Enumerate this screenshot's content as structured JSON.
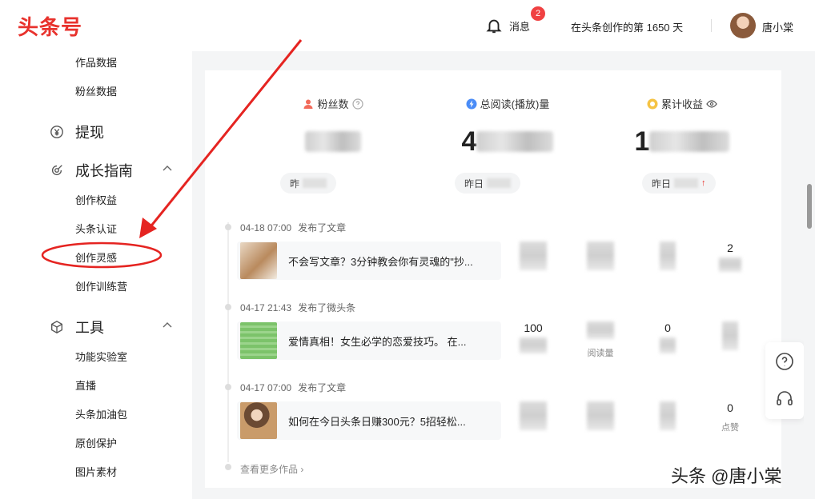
{
  "brand": {
    "logo_text": "头条号",
    "color": "#e8322d"
  },
  "header": {
    "messages_label": "消息",
    "messages_count": "2",
    "days_text": "在头条创作的第 1650 天",
    "user_name": "唐小棠"
  },
  "sidebar": {
    "data_items": [
      "作品数据",
      "粉丝数据"
    ],
    "withdraw_label": "提现",
    "growth_label": "成长指南",
    "growth_items": [
      "创作权益",
      "头条认证",
      "创作灵感",
      "创作训练营"
    ],
    "tools_label": "工具",
    "tools_items": [
      "功能实验室",
      "直播",
      "头条加油包",
      "原创保护",
      "图片素材"
    ]
  },
  "stats": {
    "fans_label": "粉丝数",
    "reads_label": "总阅读(播放)量",
    "income_label": "累计收益",
    "fans_value_visible": "",
    "reads_value_visible": "4",
    "income_value_visible": "1",
    "yesterday_label": "昨",
    "yesterday_label_full": "昨日"
  },
  "entries": [
    {
      "time": "04-18 07:00",
      "action": "发布了文章",
      "title": "不会写文章？3分钟教会你有灵魂的\"抄...",
      "likes": "2",
      "likes_label": ""
    },
    {
      "time": "04-17 21:43",
      "action": "发布了微头条",
      "title": "爱情真相！女生必学的恋爱技巧。 在...",
      "col1": "100",
      "col3": "0",
      "read_label": "阅读量"
    },
    {
      "time": "04-17 07:00",
      "action": "发布了文章",
      "title": "如何在今日头条日赚300元？5招轻松...",
      "likes": "0",
      "likes_label": "点赞"
    }
  ],
  "read_label": "阅读量",
  "more_label": "查看更多作品",
  "watermark": "头条 @唐小棠",
  "icons": {
    "bell": "bell-icon",
    "withdraw": "yen-circle-icon",
    "growth": "growth-icon",
    "tools": "cube-icon",
    "help": "help-icon",
    "service": "headset-icon"
  },
  "colors": {
    "accent": "#e8322d",
    "badge": "#f04142",
    "annotation": "#e52421"
  }
}
